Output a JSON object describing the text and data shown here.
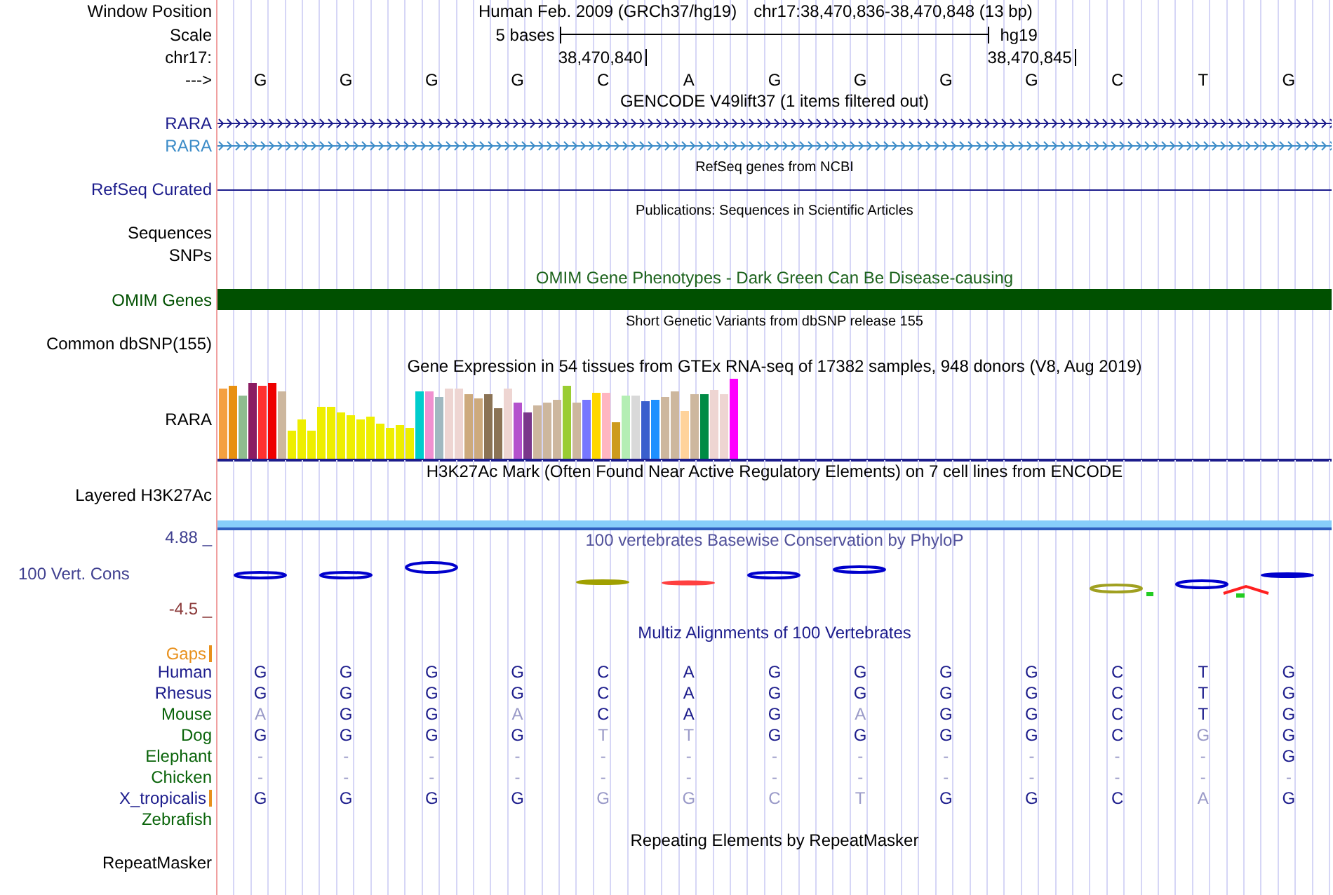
{
  "header": {
    "position_label": "Window Position",
    "assembly": "Human Feb. 2009 (GRCh37/hg19)",
    "position": "chr17:38,470,836-38,470,848 (13 bp)",
    "scale_label": "Scale",
    "scale_length": "5 bases",
    "scale_assembly": "hg19",
    "chrom_label": "chr17:",
    "strand_label": "--->",
    "bases": [
      {
        "base": "G"
      },
      {
        "base": "G"
      },
      {
        "base": "G"
      },
      {
        "base": "G"
      },
      {
        "base": "C",
        "coordinate": "38,470,840"
      },
      {
        "base": "A"
      },
      {
        "base": "G"
      },
      {
        "base": "G"
      },
      {
        "base": "G"
      },
      {
        "base": "G",
        "coordinate": "38,470,845"
      },
      {
        "base": "C"
      },
      {
        "base": "T"
      },
      {
        "base": "G"
      }
    ]
  },
  "tracks": [
    {
      "kind": "title",
      "text": "GENCODE V49lift37 (1 items filtered out)",
      "color": "#000000"
    },
    {
      "kind": "gene",
      "label": "RARA",
      "color": "#1c1c8c"
    },
    {
      "kind": "gene",
      "label": "RARA",
      "color": "#3c8cc8"
    },
    {
      "kind": "small_title",
      "text": "RefSeq genes from NCBI",
      "color": "#000000"
    },
    {
      "kind": "line",
      "label": "RefSeq Curated",
      "color": "#1c1c8c"
    },
    {
      "kind": "small_title",
      "text": "Publications: Sequences in Scientific Articles",
      "color": "#000000"
    },
    {
      "kind": "label",
      "label": "Sequences",
      "color": "#000000"
    },
    {
      "kind": "label",
      "label": "SNPs",
      "color": "#000000"
    },
    {
      "kind": "title",
      "text": "OMIM Gene Phenotypes - Dark Green Can Be Disease-causing",
      "color": "#1e641e"
    },
    {
      "kind": "bar",
      "label": "OMIM Genes",
      "color": "#005000"
    },
    {
      "kind": "small_title",
      "text": "Short Genetic Variants from dbSNP release 155",
      "color": "#000000"
    },
    {
      "kind": "label",
      "label": "Common dbSNP(155)",
      "color": "#000000"
    },
    {
      "kind": "title",
      "text": "Gene Expression in 54 tissues from GTEx RNA-seq of 17382 samples, 948 donors (V8, Aug 2019)",
      "color": "#000000"
    },
    {
      "kind": "expression",
      "label": "RARA",
      "color": "#000000"
    },
    {
      "kind": "title",
      "text": "H3K27Ac Mark (Often Found Near Active Regulatory Elements) on 7 cell lines from ENCODE",
      "color": "#000000"
    },
    {
      "kind": "signal",
      "label": "Layered H3K27Ac",
      "color": "#000000"
    },
    {
      "kind": "conservation",
      "label": "100 Vert. Cons",
      "color": "#404090",
      "title": "100 vertebrates Basewise Conservation by PhyloP",
      "axis_max": {
        "text": "4.88 _",
        "color": "#404090"
      },
      "axis_min": {
        "text": "-4.5 _",
        "color": "#8b3a3a"
      }
    },
    {
      "kind": "title",
      "text": "Multiz Alignments of 100 Vertebrates",
      "color": "#1c1c8c"
    },
    {
      "kind": "gaps",
      "label": "Gaps",
      "color": "#e8901c",
      "gap_mark": true
    },
    {
      "kind": "alignment",
      "label": "Human",
      "color": "#1c1c8c",
      "gap_mark": false,
      "bases": [
        "G",
        "G",
        "G",
        "G",
        "C",
        "A",
        "G",
        "G",
        "G",
        "G",
        "C",
        "T",
        "G"
      ],
      "faded": [
        false,
        false,
        false,
        false,
        false,
        false,
        false,
        false,
        false,
        false,
        false,
        false,
        false
      ]
    },
    {
      "kind": "alignment",
      "label": "Rhesus",
      "color": "#1c1c8c",
      "gap_mark": false,
      "bases": [
        "G",
        "G",
        "G",
        "G",
        "C",
        "A",
        "G",
        "G",
        "G",
        "G",
        "C",
        "T",
        "G"
      ],
      "faded": [
        false,
        false,
        false,
        false,
        false,
        false,
        false,
        false,
        false,
        false,
        false,
        false,
        false
      ]
    },
    {
      "kind": "alignment",
      "label": "Mouse",
      "color": "#0a640a",
      "gap_mark": false,
      "bases": [
        "A",
        "G",
        "G",
        "A",
        "C",
        "A",
        "G",
        "A",
        "G",
        "G",
        "C",
        "T",
        "G"
      ],
      "faded": [
        true,
        false,
        false,
        true,
        false,
        false,
        false,
        true,
        false,
        false,
        false,
        false,
        false
      ]
    },
    {
      "kind": "alignment",
      "label": "Dog",
      "color": "#0a640a",
      "gap_mark": false,
      "bases": [
        "G",
        "G",
        "G",
        "G",
        "T",
        "T",
        "G",
        "G",
        "G",
        "G",
        "C",
        "G",
        "G"
      ],
      "faded": [
        false,
        false,
        false,
        false,
        true,
        true,
        false,
        false,
        false,
        false,
        false,
        true,
        false
      ]
    },
    {
      "kind": "alignment",
      "label": "Elephant",
      "color": "#0a640a",
      "gap_mark": false,
      "bases": [
        "-",
        "-",
        "-",
        "-",
        "-",
        "-",
        "-",
        "-",
        "-",
        "-",
        "-",
        "-",
        "G"
      ],
      "faded": [
        true,
        true,
        true,
        true,
        true,
        true,
        true,
        true,
        true,
        true,
        true,
        true,
        false
      ]
    },
    {
      "kind": "alignment",
      "label": "Chicken",
      "color": "#0a640a",
      "gap_mark": false,
      "bases": [
        "-",
        "-",
        "-",
        "-",
        "-",
        "-",
        "-",
        "-",
        "-",
        "-",
        "-",
        "-",
        "-"
      ],
      "faded": [
        true,
        true,
        true,
        true,
        true,
        true,
        true,
        true,
        true,
        true,
        true,
        true,
        true
      ]
    },
    {
      "kind": "alignment",
      "label": "X_tropicalis",
      "color": "#1c1c8c",
      "gap_mark": true,
      "bases": [
        "G",
        "G",
        "G",
        "G",
        "G",
        "G",
        "C",
        "T",
        "G",
        "G",
        "C",
        "A",
        "G"
      ],
      "faded": [
        false,
        false,
        false,
        false,
        true,
        true,
        true,
        true,
        false,
        false,
        false,
        true,
        false
      ]
    },
    {
      "kind": "alignment",
      "label": "Zebrafish",
      "color": "#0a640a",
      "gap_mark": false
    },
    {
      "kind": "title",
      "text": "Repeating Elements by RepeatMasker",
      "color": "#000000"
    },
    {
      "kind": "label",
      "label": "RepeatMasker",
      "color": "#000000"
    }
  ]
}
